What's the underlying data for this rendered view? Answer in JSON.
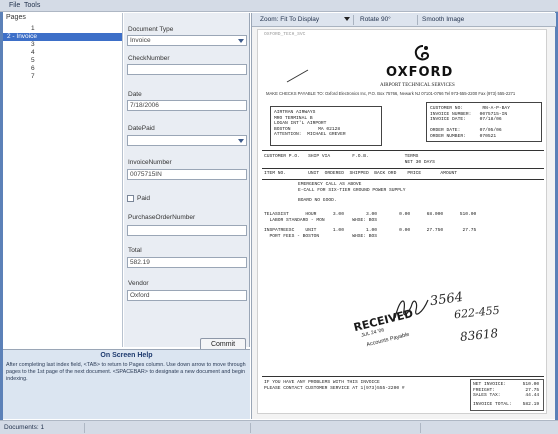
{
  "menu": {
    "file": "File",
    "tools": "Tools"
  },
  "pages": {
    "header": "Pages",
    "items": [
      {
        "label": "1",
        "selected": false
      },
      {
        "label": "2 - Invoice",
        "selected": true
      },
      {
        "label": "3",
        "selected": false
      },
      {
        "label": "4",
        "selected": false
      },
      {
        "label": "5",
        "selected": false
      },
      {
        "label": "6",
        "selected": false
      },
      {
        "label": "7",
        "selected": false
      }
    ]
  },
  "fields": {
    "document_type_label": "Document Type",
    "document_type_value": "Invoice",
    "check_number_label": "CheckNumber",
    "check_number_value": "",
    "date_label": "Date",
    "date_value": "7/18/2006",
    "date_paid_label": "DatePaid",
    "date_paid_value": "",
    "invoice_number_label": "InvoiceNumber",
    "invoice_number_value": "0075715IN",
    "paid_label": "Paid",
    "paid_checked": false,
    "po_number_label": "PurchaseOrderNumber",
    "po_number_value": "",
    "total_label": "Total",
    "total_value": "582.19",
    "vendor_label": "Vendor",
    "vendor_value": "Oxford",
    "commit_label": "Commit"
  },
  "help": {
    "title": "On Screen Help",
    "text": "After completing last index field, <TAB> to return to Pages column. Use down arrow to move through pages to the 1st page of the next document. <SPACEBAR> to designate a new document and begin indexing."
  },
  "toolbar": {
    "zoom_label": "Zoom: Fit To Display",
    "rotate_label": "Rotate 90°",
    "smooth_label": "Smooth Image"
  },
  "document": {
    "top_header": "OXFORD_TECH_SVC",
    "logo_text": "OXFORD",
    "logo_sub": "AIRPORT TECHNICAL SERVICES",
    "address_line": "MAKE CHECKS PAYABLE TO: Oxford Electronics Inc, P.O. Box 75766, Newark NJ 07101-0766  Tel 973-555-2200  Fax (973) 555-2271",
    "ship_to": "AIRTRAN AIRWAYS\nMRO TERMINAL B\nLOGAN INT'L AIRPORT\nBOSTON          MA 02128\nATTENTION:  MICHAEL GREVER",
    "customer_info": "CUSTOMER NO:       RN-A-P-BAY\nINVOICE NUMBER:   0075715-IN\nINVOICE DATE:     07/18/06\n\nORDER DATE:       07/05/06\nORDER NUMBER:     070521",
    "terms_row": "CUSTOMER P.O.   SHIP VIA        F.O.B.             TERMS\n                                                   NET 30 DAYS",
    "cols_row": "ITEM NO.        UNIT  ORDERED  SHIPPED  BACK ORD    PRICE       AMOUNT",
    "emergency": "EMERGENCY CALL AS ABOVE\nE-CALL FOR SIX-TIER GROUND POWER SUPPLY",
    "board": "BOARD NO GOOD.",
    "line1": "TELASSIST      HOUR      3.00        3.00        0.00      68.000      510.00\n  LABOR STANDARD - MON          WHSE: BOS",
    "line2": "INSPATREESC    UNIT      1.00        1.00        0.00      27.750       27.75\n  PORT FEES - BOSTON            WHSE: BOS",
    "footer_note": "IF YOU HAVE ANY PROBLEMS WITH THIS INVOICE\nPLEASE CONTACT CUSTOMER SERVICE AT 1(973)555-2200 #",
    "totals": "NET INVOICE:      510.00\nFREIGHT:           27.75\nSALES TAX:         44.44",
    "invoice_total": "INVOICE TOTAL:    582.19",
    "received_stamp": "RECEIVED",
    "stamp_date": "JUL 24 '06",
    "stamp_ap": "Accounts Payable",
    "handwriting_1": "3564",
    "handwriting_2": "622-455",
    "handwriting_3": "83618"
  },
  "status": {
    "documents_label": "Documents: 1"
  },
  "colors": {
    "accent": "#3d6fc8",
    "frame": "#5c81b8",
    "help_bg": "#dbe5f1",
    "fields_bg": "#e9edf3"
  }
}
